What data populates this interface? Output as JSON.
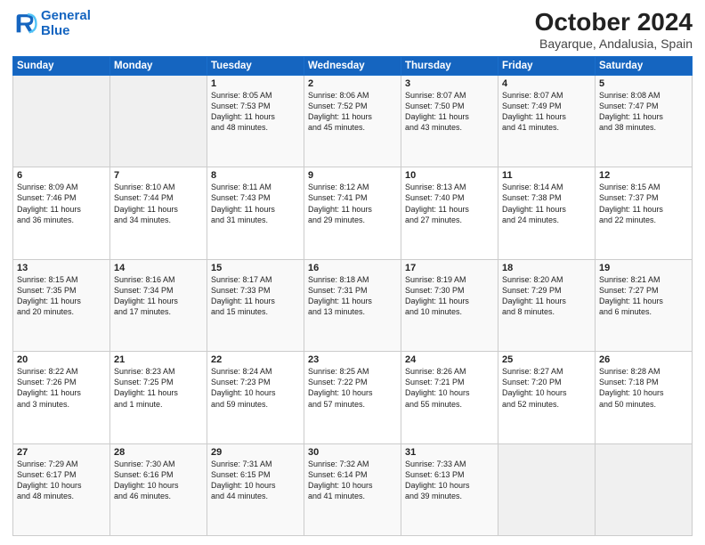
{
  "logo": {
    "line1": "General",
    "line2": "Blue"
  },
  "title": "October 2024",
  "subtitle": "Bayarque, Andalusia, Spain",
  "days_of_week": [
    "Sunday",
    "Monday",
    "Tuesday",
    "Wednesday",
    "Thursday",
    "Friday",
    "Saturday"
  ],
  "weeks": [
    [
      {
        "day": "",
        "empty": true
      },
      {
        "day": "",
        "empty": true
      },
      {
        "day": "1",
        "lines": [
          "Sunrise: 8:05 AM",
          "Sunset: 7:53 PM",
          "Daylight: 11 hours",
          "and 48 minutes."
        ]
      },
      {
        "day": "2",
        "lines": [
          "Sunrise: 8:06 AM",
          "Sunset: 7:52 PM",
          "Daylight: 11 hours",
          "and 45 minutes."
        ]
      },
      {
        "day": "3",
        "lines": [
          "Sunrise: 8:07 AM",
          "Sunset: 7:50 PM",
          "Daylight: 11 hours",
          "and 43 minutes."
        ]
      },
      {
        "day": "4",
        "lines": [
          "Sunrise: 8:07 AM",
          "Sunset: 7:49 PM",
          "Daylight: 11 hours",
          "and 41 minutes."
        ]
      },
      {
        "day": "5",
        "lines": [
          "Sunrise: 8:08 AM",
          "Sunset: 7:47 PM",
          "Daylight: 11 hours",
          "and 38 minutes."
        ]
      }
    ],
    [
      {
        "day": "6",
        "lines": [
          "Sunrise: 8:09 AM",
          "Sunset: 7:46 PM",
          "Daylight: 11 hours",
          "and 36 minutes."
        ]
      },
      {
        "day": "7",
        "lines": [
          "Sunrise: 8:10 AM",
          "Sunset: 7:44 PM",
          "Daylight: 11 hours",
          "and 34 minutes."
        ]
      },
      {
        "day": "8",
        "lines": [
          "Sunrise: 8:11 AM",
          "Sunset: 7:43 PM",
          "Daylight: 11 hours",
          "and 31 minutes."
        ]
      },
      {
        "day": "9",
        "lines": [
          "Sunrise: 8:12 AM",
          "Sunset: 7:41 PM",
          "Daylight: 11 hours",
          "and 29 minutes."
        ]
      },
      {
        "day": "10",
        "lines": [
          "Sunrise: 8:13 AM",
          "Sunset: 7:40 PM",
          "Daylight: 11 hours",
          "and 27 minutes."
        ]
      },
      {
        "day": "11",
        "lines": [
          "Sunrise: 8:14 AM",
          "Sunset: 7:38 PM",
          "Daylight: 11 hours",
          "and 24 minutes."
        ]
      },
      {
        "day": "12",
        "lines": [
          "Sunrise: 8:15 AM",
          "Sunset: 7:37 PM",
          "Daylight: 11 hours",
          "and 22 minutes."
        ]
      }
    ],
    [
      {
        "day": "13",
        "lines": [
          "Sunrise: 8:15 AM",
          "Sunset: 7:35 PM",
          "Daylight: 11 hours",
          "and 20 minutes."
        ]
      },
      {
        "day": "14",
        "lines": [
          "Sunrise: 8:16 AM",
          "Sunset: 7:34 PM",
          "Daylight: 11 hours",
          "and 17 minutes."
        ]
      },
      {
        "day": "15",
        "lines": [
          "Sunrise: 8:17 AM",
          "Sunset: 7:33 PM",
          "Daylight: 11 hours",
          "and 15 minutes."
        ]
      },
      {
        "day": "16",
        "lines": [
          "Sunrise: 8:18 AM",
          "Sunset: 7:31 PM",
          "Daylight: 11 hours",
          "and 13 minutes."
        ]
      },
      {
        "day": "17",
        "lines": [
          "Sunrise: 8:19 AM",
          "Sunset: 7:30 PM",
          "Daylight: 11 hours",
          "and 10 minutes."
        ]
      },
      {
        "day": "18",
        "lines": [
          "Sunrise: 8:20 AM",
          "Sunset: 7:29 PM",
          "Daylight: 11 hours",
          "and 8 minutes."
        ]
      },
      {
        "day": "19",
        "lines": [
          "Sunrise: 8:21 AM",
          "Sunset: 7:27 PM",
          "Daylight: 11 hours",
          "and 6 minutes."
        ]
      }
    ],
    [
      {
        "day": "20",
        "lines": [
          "Sunrise: 8:22 AM",
          "Sunset: 7:26 PM",
          "Daylight: 11 hours",
          "and 3 minutes."
        ]
      },
      {
        "day": "21",
        "lines": [
          "Sunrise: 8:23 AM",
          "Sunset: 7:25 PM",
          "Daylight: 11 hours",
          "and 1 minute."
        ]
      },
      {
        "day": "22",
        "lines": [
          "Sunrise: 8:24 AM",
          "Sunset: 7:23 PM",
          "Daylight: 10 hours",
          "and 59 minutes."
        ]
      },
      {
        "day": "23",
        "lines": [
          "Sunrise: 8:25 AM",
          "Sunset: 7:22 PM",
          "Daylight: 10 hours",
          "and 57 minutes."
        ]
      },
      {
        "day": "24",
        "lines": [
          "Sunrise: 8:26 AM",
          "Sunset: 7:21 PM",
          "Daylight: 10 hours",
          "and 55 minutes."
        ]
      },
      {
        "day": "25",
        "lines": [
          "Sunrise: 8:27 AM",
          "Sunset: 7:20 PM",
          "Daylight: 10 hours",
          "and 52 minutes."
        ]
      },
      {
        "day": "26",
        "lines": [
          "Sunrise: 8:28 AM",
          "Sunset: 7:18 PM",
          "Daylight: 10 hours",
          "and 50 minutes."
        ]
      }
    ],
    [
      {
        "day": "27",
        "lines": [
          "Sunrise: 7:29 AM",
          "Sunset: 6:17 PM",
          "Daylight: 10 hours",
          "and 48 minutes."
        ]
      },
      {
        "day": "28",
        "lines": [
          "Sunrise: 7:30 AM",
          "Sunset: 6:16 PM",
          "Daylight: 10 hours",
          "and 46 minutes."
        ]
      },
      {
        "day": "29",
        "lines": [
          "Sunrise: 7:31 AM",
          "Sunset: 6:15 PM",
          "Daylight: 10 hours",
          "and 44 minutes."
        ]
      },
      {
        "day": "30",
        "lines": [
          "Sunrise: 7:32 AM",
          "Sunset: 6:14 PM",
          "Daylight: 10 hours",
          "and 41 minutes."
        ]
      },
      {
        "day": "31",
        "lines": [
          "Sunrise: 7:33 AM",
          "Sunset: 6:13 PM",
          "Daylight: 10 hours",
          "and 39 minutes."
        ]
      },
      {
        "day": "",
        "empty": true
      },
      {
        "day": "",
        "empty": true
      }
    ]
  ]
}
